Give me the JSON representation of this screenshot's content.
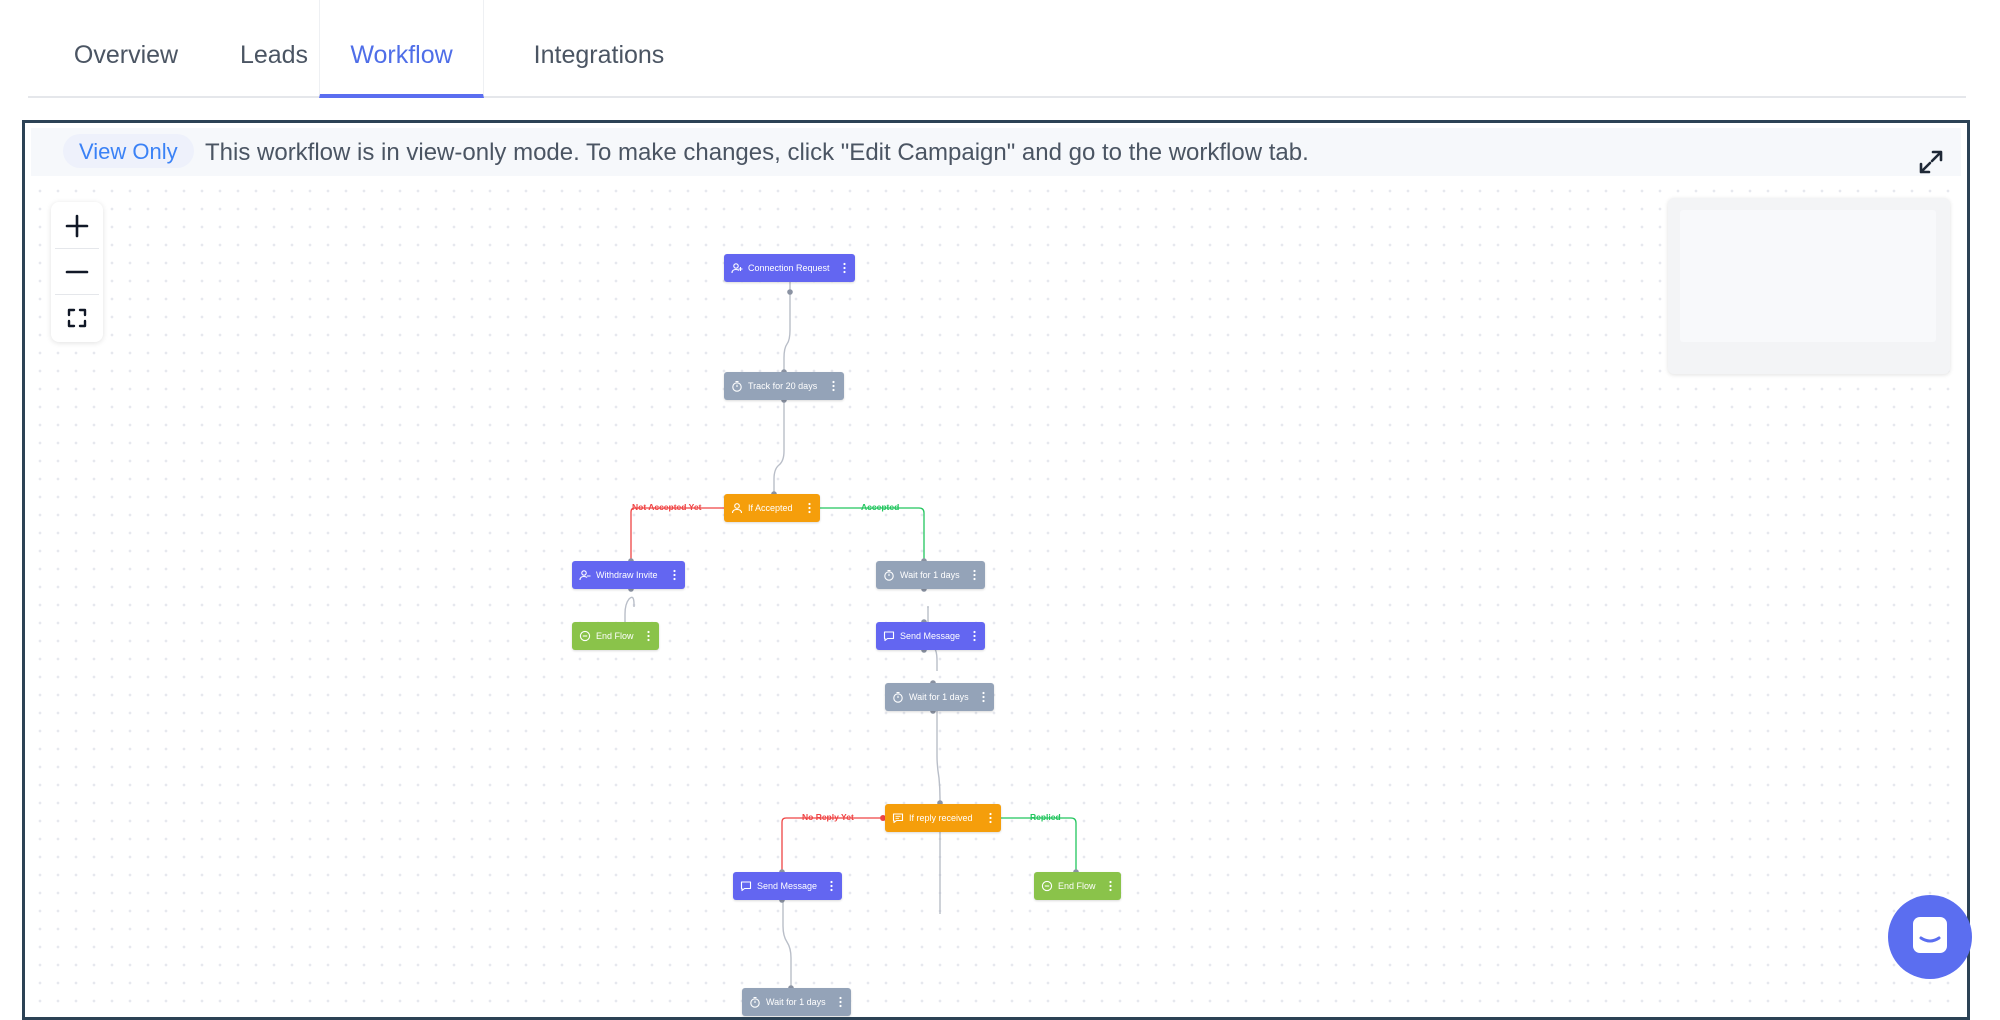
{
  "tabs": [
    {
      "label": "Overview",
      "active": false
    },
    {
      "label": "Leads",
      "active": false
    },
    {
      "label": "Workflow",
      "active": true
    },
    {
      "label": "Integrations",
      "active": false
    }
  ],
  "banner": {
    "badge": "View Only",
    "message": "This workflow is in view-only mode. To make changes, click \"Edit Campaign\" and go to the workflow tab."
  },
  "controls": {
    "zoom_in_icon": "plus-icon",
    "zoom_out_icon": "minus-icon",
    "fit_view_icon": "fit-view-icon",
    "expand_icon": "expand-icon"
  },
  "workflow": {
    "nodes": {
      "connection_request": "Connection Request",
      "track": "Track for 20 days",
      "if_accepted": "If Accepted",
      "withdraw_invite": "Withdraw Invite",
      "end_flow_1": "End Flow",
      "wait_1": "Wait for 1 days",
      "send_message_1": "Send Message",
      "wait_2": "Wait for 1 days",
      "if_reply": "If reply received",
      "send_message_2": "Send Message",
      "end_flow_2": "End Flow",
      "wait_3": "Wait for 1 days"
    },
    "edge_labels": {
      "not_accepted": "Not Accepted Yet",
      "accepted": "Accepted",
      "no_reply": "No Reply Yet",
      "replied": "Replied"
    }
  },
  "colors": {
    "action": "#6366f1",
    "delay": "#94a3b8",
    "condition": "#f59e0b",
    "end": "#8ac34a",
    "accent": "#4f6ee8"
  }
}
